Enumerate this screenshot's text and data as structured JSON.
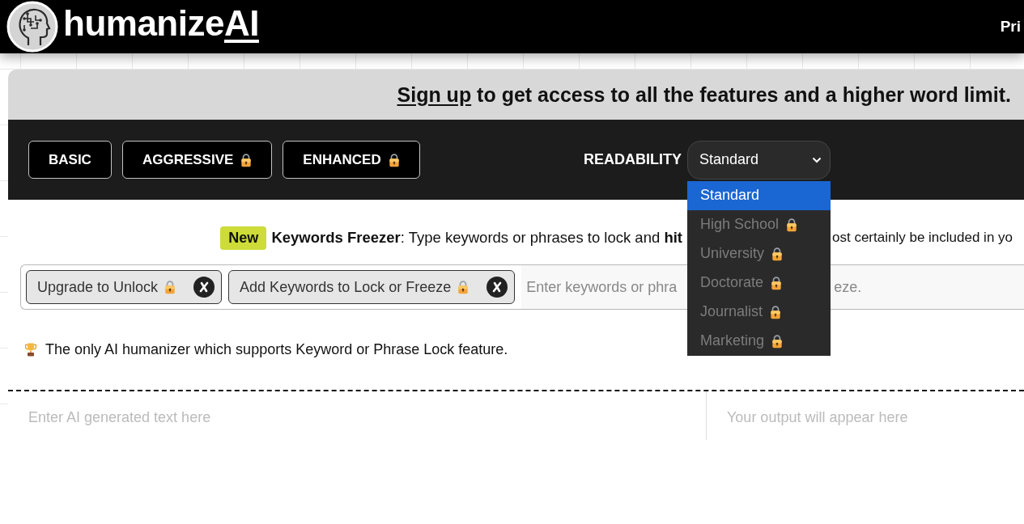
{
  "header": {
    "logo": {
      "text": "humanize",
      "accent": "AI"
    },
    "nav": [
      {
        "label": "Pri"
      }
    ]
  },
  "banner": {
    "link": "Sign up",
    "text": " to get access to all the features and a higher word limit."
  },
  "modes": [
    {
      "label": "BASIC",
      "locked": false
    },
    {
      "label": "AGGRESSIVE",
      "locked": true
    },
    {
      "label": "ENHANCED",
      "locked": true
    }
  ],
  "readability": {
    "label": "READABILITY",
    "value": "Standard",
    "expanded": true,
    "options": [
      {
        "label": "Standard",
        "selected": true,
        "disabled": false,
        "locked": false
      },
      {
        "label": "High School",
        "selected": false,
        "disabled": true,
        "locked": true
      },
      {
        "label": "University",
        "selected": false,
        "disabled": true,
        "locked": true
      },
      {
        "label": "Doctorate",
        "selected": false,
        "disabled": true,
        "locked": true
      },
      {
        "label": "Journalist",
        "selected": false,
        "disabled": true,
        "locked": true
      },
      {
        "label": "Marketing",
        "selected": false,
        "disabled": true,
        "locked": true
      }
    ]
  },
  "keywords": {
    "badge": "New",
    "intro": "**Keywords Freezer**: Type keywords or phrases to lock and **hit**",
    "intro_end": "ost certainly be included in yo",
    "chips": [
      {
        "label": "Upgrade to Unlock",
        "locked": true
      },
      {
        "label": "Add Keywords to Lock or Freeze",
        "locked": true
      }
    ],
    "placeholder": "Enter keywords or phra",
    "placeholder_end": "eze.",
    "note": "The only AI humanizer which supports Keyword or Phrase Lock feature."
  },
  "editor": {
    "input_placeholder": "Enter AI generated text here",
    "output_placeholder": "Your output will appear here"
  }
}
